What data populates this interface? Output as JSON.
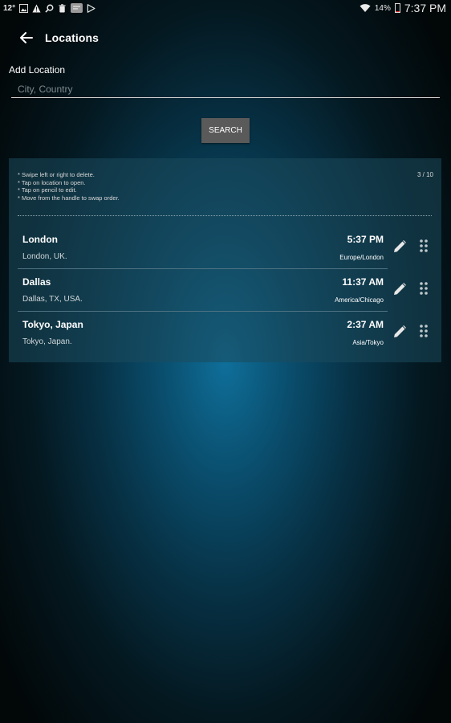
{
  "status_bar": {
    "temperature": "12°",
    "battery_percent": "14%",
    "clock": "7:37 PM",
    "icons": [
      "image-icon",
      "warning-icon",
      "search-icon",
      "trash-icon",
      "app-badge-icon",
      "play-store-icon",
      "wifi-icon",
      "battery-icon"
    ]
  },
  "appbar": {
    "title": "Locations"
  },
  "add_location": {
    "label": "Add Location",
    "placeholder": "City, Country",
    "value": ""
  },
  "search_button": {
    "label": "SEARCH"
  },
  "panel": {
    "hints": [
      "* Swipe left or right to delete.",
      "* Tap on location to open.",
      "* Tap on pencil to edit.",
      "* Move from the handle to swap order."
    ],
    "counter": "3 / 10"
  },
  "locations": [
    {
      "name": "London",
      "time": "5:37 PM",
      "full_name": "London, UK.",
      "timezone": "Europe/London"
    },
    {
      "name": "Dallas",
      "time": "11:37 AM",
      "full_name": "Dallas, TX, USA.",
      "timezone": "America/Chicago"
    },
    {
      "name": "Tokyo, Japan",
      "time": "2:37 AM",
      "full_name": "Tokyo, Japan.",
      "timezone": "Asia/Tokyo"
    }
  ],
  "colors": {
    "background_center": "#0f6f9a",
    "background_edge": "#020708",
    "button_bg": "#5a5a5a",
    "battery_low": "#e33333"
  }
}
